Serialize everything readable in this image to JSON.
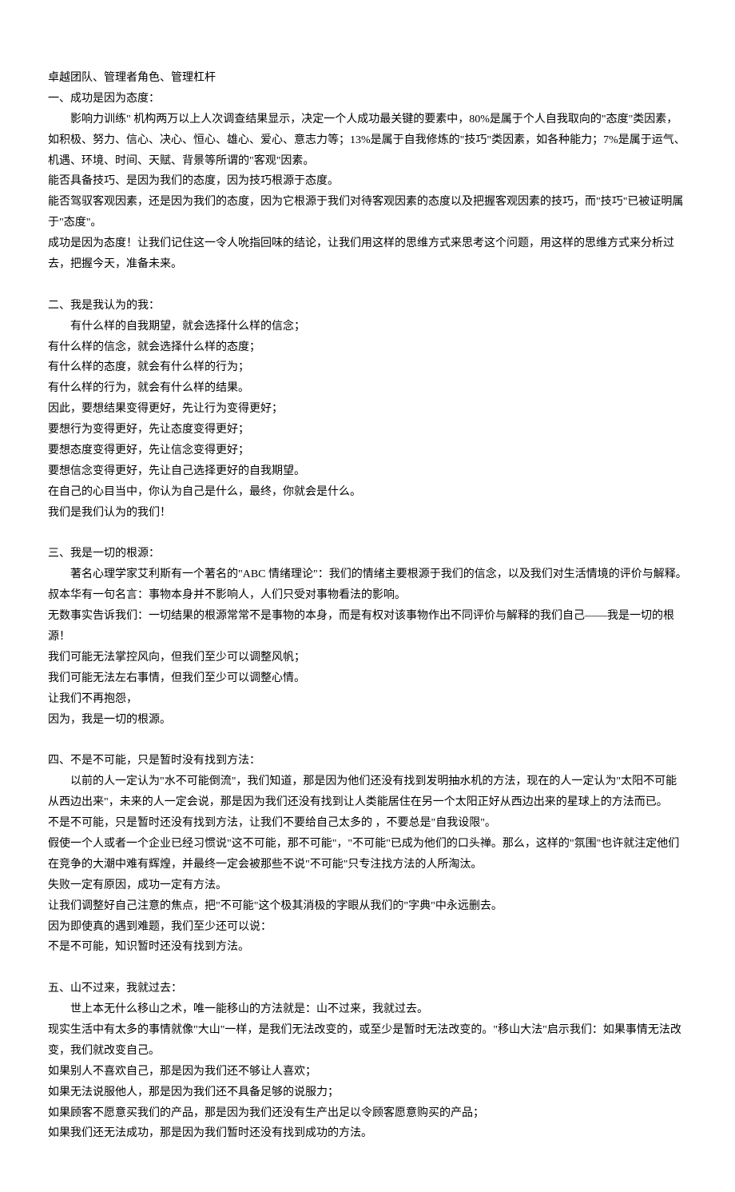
{
  "title": "卓越团队、管理者角色、管理杠杆",
  "sections": [
    {
      "heading": "一、成功是因为态度：",
      "firstIndented": "影响力训练\" 机构两万以上人次调查结果显示，决定一个人成功最关键的要素中，80%是属于个人自我取向的\"态度\"类因素，如积极、努力、信心、决心、恒心、雄心、爱心、意志力等；13%是属于自我修炼的\"技巧\"类因素，如各种能力；7%是属于运气、机遇、环境、时间、天赋、背景等所谓的\"客观\"因素。",
      "lines": [
        "能否具备技巧、是因为我们的态度，因为技巧根源于态度。",
        "能否驾驭客观因素，还是因为我们的态度，因为它根源于我们对待客观因素的态度以及把握客观因素的技巧，而\"技巧\"已被证明属于\"态度\"。",
        "成功是因为态度！让我们记住这一令人吮指回味的结论，让我们用这样的思维方式来思考这个问题，用这样的思维方式来分析过去，把握今天，准备未来。"
      ]
    },
    {
      "heading": "二、我是我认为的我：",
      "firstIndented": "有什么样的自我期望，就会选择什么样的信念；",
      "lines": [
        "有什么样的信念，就会选择什么样的态度；",
        "有什么样的态度，就会有什么样的行为；",
        "有什么样的行为，就会有什么样的结果。",
        "因此，要想结果变得更好，先让行为变得更好；",
        "要想行为变得更好，先让态度变得更好；",
        "要想态度变得更好，先让信念变得更好；",
        "要想信念变得更好，先让自己选择更好的自我期望。",
        "在自己的心目当中，你认为自己是什么，最终，你就会是什么。",
        "我们是我们认为的我们！"
      ]
    },
    {
      "heading": "三、我是一切的根源：",
      "firstIndented": "著名心理学家艾利斯有一个著名的\"ABC 情绪理论\"：我们的情绪主要根源于我们的信念，以及我们对生活情境的评价与解释。",
      "lines": [
        "叔本华有一句名言：事物本身并不影响人，人们只受对事物看法的影响。",
        "无数事实告诉我们：一切结果的根源常常不是事物的本身，而是有权对该事物作出不同评价与解释的我们自己——我是一切的根源！",
        "我们可能无法掌控风向，但我们至少可以调整风帆；",
        "我们可能无法左右事情，但我们至少可以调整心情。",
        "让我们不再抱怨，",
        "因为，我是一切的根源。"
      ]
    },
    {
      "heading": "四、不是不可能，只是暂时没有找到方法：",
      "firstIndented": "以前的人一定认为\"水不可能倒流\"，我们知道，那是因为他们还没有找到发明抽水机的方法，现在的人一定认为\"太阳不可能从西边出来\"，未来的人一定会说，那是因为我们还没有找到让人类能居住在另一个太阳正好从西边出来的星球上的方法而已。",
      "lines": [
        "不是不可能，只是暂时还没有找到方法，让我们不要给自己太多的 ，不要总是\"自我设限\"。",
        "假使一个人或者一个企业已经习惯说\"这不可能，那不可能\"，\"不可能\"已成为他们的口头禅。那么，这样的\"氛围\"也许就注定他们在竞争的大潮中难有辉煌，并最终一定会被那些不说\"不可能\"只专注找方法的人所淘汰。",
        "失败一定有原因，成功一定有方法。",
        "让我们调整好自己注意的焦点，把\"不可能\"这个极其消极的字眼从我们的\"字典\"中永远删去。",
        "因为即使真的遇到难题，我们至少还可以说：",
        "不是不可能，知识暂时还没有找到方法。"
      ]
    },
    {
      "heading": "五、山不过来，我就过去：",
      "firstIndented": "世上本无什么移山之术，唯一能移山的方法就是：山不过来，我就过去。",
      "lines": [
        "现实生活中有太多的事情就像\"大山\"一样，是我们无法改变的，或至少是暂时无法改变的。\"移山大法\"启示我们：如果事情无法改变，我们就改变自己。",
        "如果别人不喜欢自己，那是因为我们还不够让人喜欢；",
        "如果无法说服他人，那是因为我们还不具备足够的说服力；",
        "如果顾客不愿意买我们的产品，那是因为我们还没有生产出足以令顾客愿意购买的产品；",
        "如果我们还无法成功，那是因为我们暂时还没有找到成功的方法。"
      ]
    }
  ]
}
